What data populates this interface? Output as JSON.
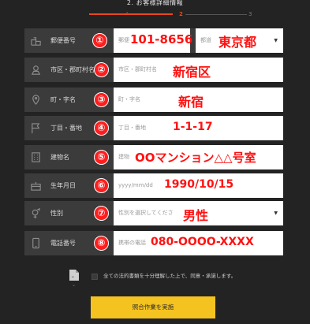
{
  "header": {
    "step_title": "2. お客様詳細情報"
  },
  "progress": {
    "step1_mark": "✓",
    "step2_mark": "2",
    "step3_mark": "3"
  },
  "rows": [
    {
      "label": "郵便番号",
      "placeholder": "郵便",
      "placeholder2": "都道",
      "icon": "house-icon"
    },
    {
      "label": "市区・郡町村名",
      "placeholder": "市区・郡町村名",
      "icon": "map-icon"
    },
    {
      "label": "町・字名",
      "placeholder": "町・字名",
      "icon": "location-pin-icon"
    },
    {
      "label": "丁目・番地",
      "placeholder": "丁目・番地",
      "icon": "flag-icon"
    },
    {
      "label": "建物名",
      "placeholder": "建物",
      "icon": "building-icon"
    },
    {
      "label": "生年月日",
      "placeholder": "yyyy/mm/dd",
      "icon": "cake-icon"
    },
    {
      "label": "性別",
      "placeholder": "性別を選択してくださ",
      "icon": "gender-icon"
    },
    {
      "label": "電話番号",
      "placeholder": "携帯の電話",
      "icon": "phone-icon"
    }
  ],
  "annotations": {
    "zip": "101-8656",
    "prefecture": "東京都",
    "city": "新宿区",
    "town": "新宿",
    "block": "1-1-17",
    "building": "OOマンション△△号室",
    "birthday": "1990/10/15",
    "gender": "男性",
    "phone": "080-OOOO-XXXX"
  },
  "badges": [
    "①",
    "②",
    "③",
    "④",
    "⑤",
    "⑥",
    "⑦",
    "⑧"
  ],
  "agreement": {
    "text": "全ての法的書類を十分理解した上で、同意・承諾します。"
  },
  "submit": {
    "label": "照合作業を実施"
  },
  "colors": {
    "accent": "#e8491d",
    "annotation": "#ff1111",
    "submit": "#f5c320",
    "background": "#232323"
  }
}
